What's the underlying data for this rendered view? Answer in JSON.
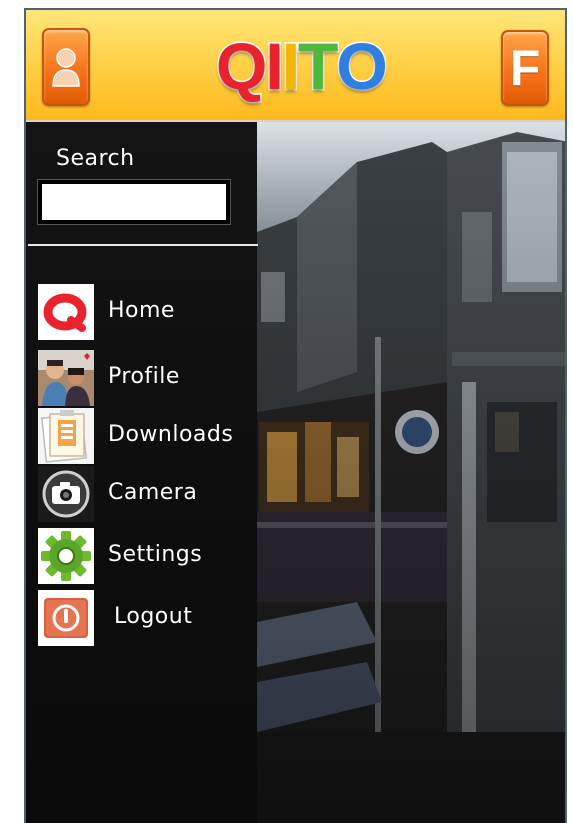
{
  "header": {
    "logo_letters": [
      {
        "char": "Q",
        "color": "#e8232d"
      },
      {
        "char": "I",
        "color": "#e8232d"
      },
      {
        "char": "I",
        "color": "#f2b705"
      },
      {
        "char": "T",
        "color": "#4fb83a"
      },
      {
        "char": "O",
        "color": "#2f7fe0"
      }
    ],
    "right_button_label": "F",
    "left_button_icon": "user-icon"
  },
  "sidebar": {
    "search_label": "Search",
    "search_value": "",
    "items": [
      {
        "label": "Home",
        "icon": "home-q-icon"
      },
      {
        "label": "Profile",
        "icon": "profile-photo-icon"
      },
      {
        "label": "Downloads",
        "icon": "downloads-icon"
      },
      {
        "label": "Camera",
        "icon": "camera-icon"
      },
      {
        "label": "Settings",
        "icon": "gear-icon"
      },
      {
        "label": "Logout",
        "icon": "power-icon"
      }
    ]
  },
  "colors": {
    "header_top": "#ffe77a",
    "header_bottom": "#ffb81c",
    "button_orange": "#f7731a",
    "sidebar_bg": "#111111"
  }
}
